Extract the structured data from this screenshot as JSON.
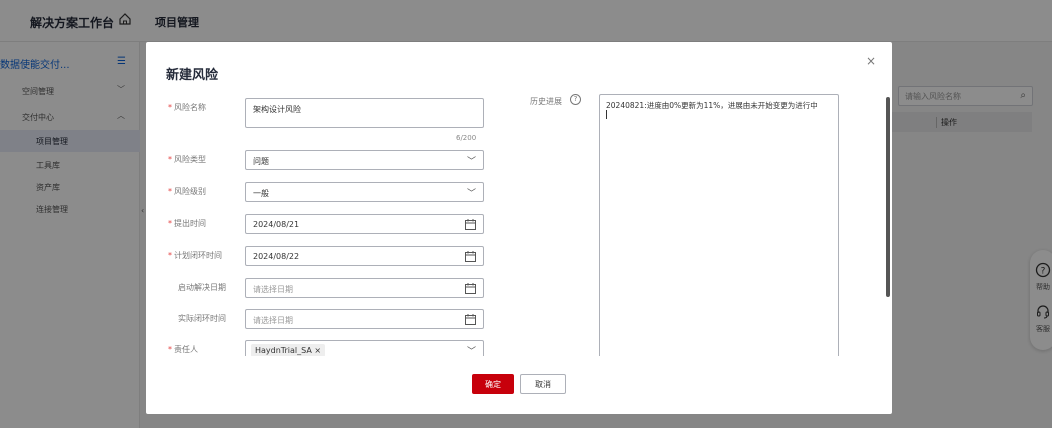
{
  "app": {
    "title": "解决方案工作台",
    "page_title": "项目管理"
  },
  "sidebar": {
    "header": "数据使能交付...",
    "items": [
      {
        "label": "空间管理",
        "chevron": "﹀"
      },
      {
        "label": "交付中心",
        "chevron": "︿"
      },
      {
        "label": "项目管理"
      },
      {
        "label": "工具库"
      },
      {
        "label": "资产库"
      },
      {
        "label": "连接管理"
      }
    ]
  },
  "right_panel": {
    "search_placeholder": "请输入风险名称",
    "table_header_op": "操作"
  },
  "float_help": {
    "help": "帮助",
    "service": "客服"
  },
  "modal": {
    "title": "新建风险",
    "close": "×",
    "fields": {
      "name": {
        "label": "风险名称",
        "value": "架构设计风险",
        "counter": "6/200"
      },
      "type": {
        "label": "风险类型",
        "value": "问题"
      },
      "level": {
        "label": "风险级别",
        "value": "一般"
      },
      "raised": {
        "label": "提出时间",
        "value": "2024/08/21"
      },
      "planned_close": {
        "label": "计划闭环时间",
        "value": "2024/08/22"
      },
      "start_resolve": {
        "label": "启动解决日期",
        "placeholder": "请选择日期"
      },
      "actual_close": {
        "label": "实际闭环时间",
        "placeholder": "请选择日期"
      },
      "owner": {
        "label": "责任人",
        "tag": "HaydnTrial_SA"
      }
    },
    "history": {
      "label": "历史进展",
      "help": "?",
      "text": "20240821:进度由0%更新为11%，进展由未开始变更为进行中"
    },
    "footer": {
      "ok": "确定",
      "cancel": "取消"
    }
  },
  "colors": {
    "primary": "#c7000b",
    "link": "#0b63d9",
    "required": "#e54545"
  }
}
